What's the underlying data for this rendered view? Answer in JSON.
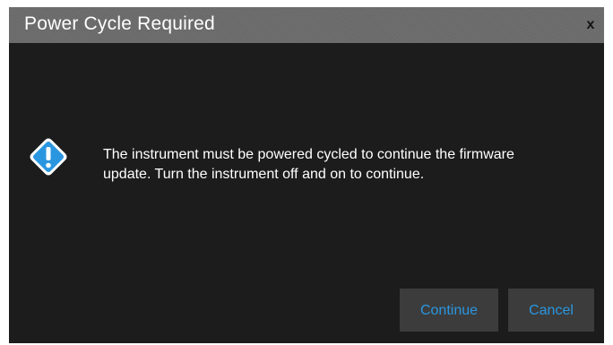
{
  "dialog": {
    "title": "Power Cycle Required",
    "close_label": "x",
    "message_line1": "The instrument must be powered cycled to continue the firmware",
    "message_line2": "update. Turn the instrument off and on to continue.",
    "icon": "exclamation-diamond-icon",
    "buttons": {
      "continue_label": "Continue",
      "cancel_label": "Cancel"
    }
  },
  "colors": {
    "background": "#1c1c1c",
    "title_bar": "#6a6a6a",
    "button_bg": "#3c3c3c",
    "accent": "#2a96e0",
    "text": "#ffffff"
  }
}
